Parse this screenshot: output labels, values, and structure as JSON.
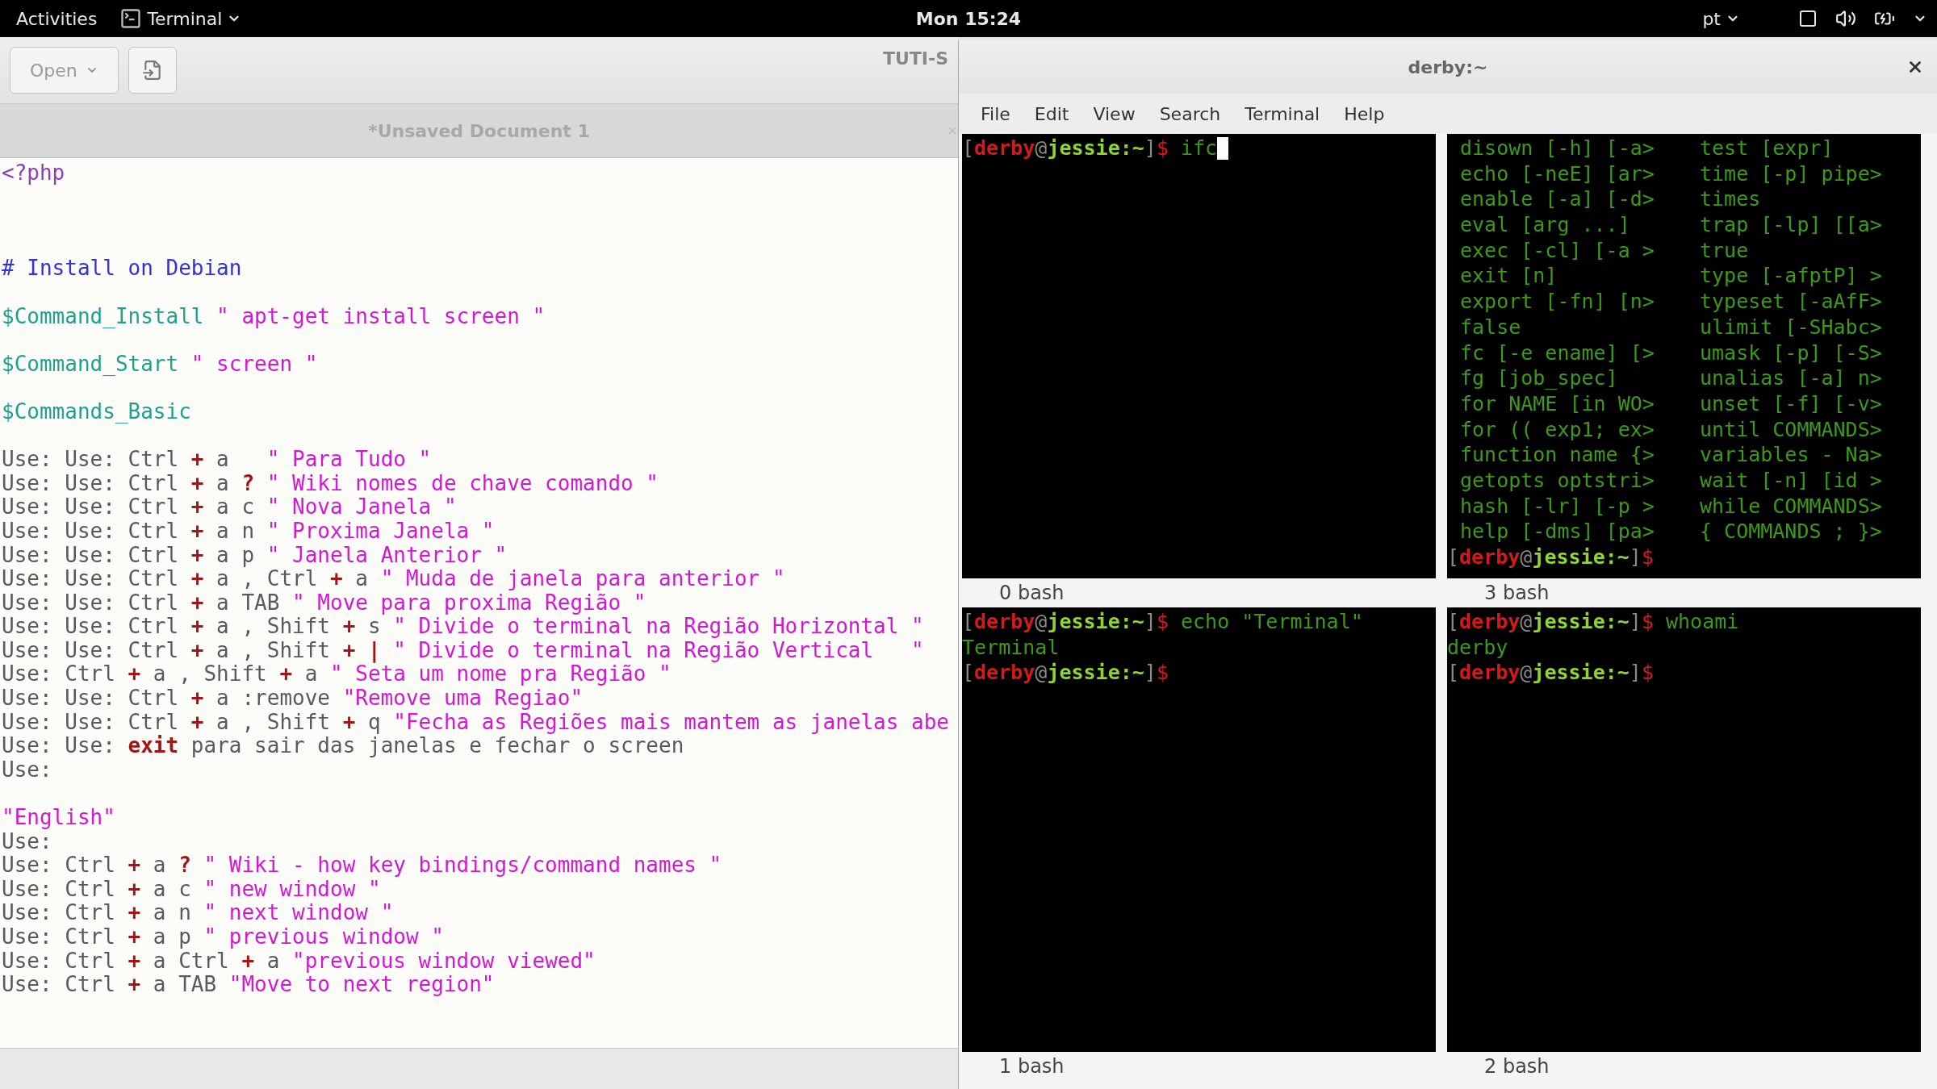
{
  "top_bar": {
    "activities": "Activities",
    "app_menu": "Terminal",
    "clock": "Mon 15:24",
    "keyboard_layout": "pt"
  },
  "editor": {
    "open_button": "Open",
    "title": "TUTI-S",
    "tab": {
      "label": "*Unsaved Document 1"
    },
    "blocks": [
      {
        "lines": [
          {
            "segments": [
              {
                "kind": "tag",
                "text": "<?php"
              }
            ]
          }
        ]
      },
      {
        "lines": [
          {
            "segments": [
              {
                "kind": "comment",
                "text": "# Install on Debian"
              }
            ]
          }
        ]
      },
      {
        "lines": [
          {
            "segments": [
              {
                "kind": "var",
                "text": "$Command_Install"
              },
              {
                "kind": "string",
                "text": " \" apt-get install screen \""
              }
            ]
          }
        ]
      },
      {
        "lines": [
          {
            "segments": [
              {
                "kind": "var",
                "text": "$Command_Start"
              },
              {
                "kind": "string",
                "text": " \" screen \""
              }
            ]
          }
        ]
      },
      {
        "lines": [
          {
            "segments": [
              {
                "kind": "var",
                "text": "$Commands_Basic"
              }
            ]
          }
        ]
      },
      {
        "lines": [
          {
            "segments": [
              {
                "kind": "plain",
                "text": "Use: Use: Ctrl "
              },
              {
                "kind": "key",
                "text": "+"
              },
              {
                "kind": "plain",
                "text": " a   "
              },
              {
                "kind": "string",
                "text": "\" Para Tudo \""
              }
            ]
          },
          {
            "segments": [
              {
                "kind": "plain",
                "text": "Use: Use: Ctrl "
              },
              {
                "kind": "key",
                "text": "+"
              },
              {
                "kind": "plain",
                "text": " a "
              },
              {
                "kind": "key",
                "text": "?"
              },
              {
                "kind": "string",
                "text": " \" Wiki nomes de chave comando \""
              }
            ]
          },
          {
            "segments": [
              {
                "kind": "plain",
                "text": "Use: Use: Ctrl "
              },
              {
                "kind": "key",
                "text": "+"
              },
              {
                "kind": "plain",
                "text": " a c "
              },
              {
                "kind": "string",
                "text": "\" Nova Janela \""
              }
            ]
          },
          {
            "segments": [
              {
                "kind": "plain",
                "text": "Use: Use: Ctrl "
              },
              {
                "kind": "key",
                "text": "+"
              },
              {
                "kind": "plain",
                "text": " a n "
              },
              {
                "kind": "string",
                "text": "\" Proxima Janela \""
              }
            ]
          },
          {
            "segments": [
              {
                "kind": "plain",
                "text": "Use: Use: Ctrl "
              },
              {
                "kind": "key",
                "text": "+"
              },
              {
                "kind": "plain",
                "text": " a p "
              },
              {
                "kind": "string",
                "text": "\" Janela Anterior \""
              }
            ]
          },
          {
            "segments": [
              {
                "kind": "plain",
                "text": "Use: Use: Ctrl "
              },
              {
                "kind": "key",
                "text": "+"
              },
              {
                "kind": "plain",
                "text": " a , Ctrl "
              },
              {
                "kind": "key",
                "text": "+"
              },
              {
                "kind": "plain",
                "text": " a "
              },
              {
                "kind": "string",
                "text": "\" Muda de janela para anterior \""
              }
            ]
          },
          {
            "segments": [
              {
                "kind": "plain",
                "text": "Use: Use: Ctrl "
              },
              {
                "kind": "key",
                "text": "+"
              },
              {
                "kind": "plain",
                "text": " a TAB "
              },
              {
                "kind": "string",
                "text": "\" Move para proxima Região \""
              }
            ]
          },
          {
            "segments": [
              {
                "kind": "plain",
                "text": "Use: Use: Ctrl "
              },
              {
                "kind": "key",
                "text": "+"
              },
              {
                "kind": "plain",
                "text": " a , Shift "
              },
              {
                "kind": "key",
                "text": "+"
              },
              {
                "kind": "plain",
                "text": " s "
              },
              {
                "kind": "string",
                "text": "\" Divide o terminal na Região Horizontal \""
              }
            ]
          },
          {
            "segments": [
              {
                "kind": "plain",
                "text": "Use: Use: Ctrl "
              },
              {
                "kind": "key",
                "text": "+"
              },
              {
                "kind": "plain",
                "text": " a , Shift "
              },
              {
                "kind": "key",
                "text": "+ |"
              },
              {
                "kind": "string",
                "text": " \" Divide o terminal na Região Vertical   \""
              }
            ]
          },
          {
            "segments": [
              {
                "kind": "plain",
                "text": "Use: Ctrl "
              },
              {
                "kind": "key",
                "text": "+"
              },
              {
                "kind": "plain",
                "text": " a , Shift "
              },
              {
                "kind": "key",
                "text": "+"
              },
              {
                "kind": "plain",
                "text": " a "
              },
              {
                "kind": "string",
                "text": "\" Seta um nome pra Região \""
              }
            ]
          },
          {
            "segments": [
              {
                "kind": "plain",
                "text": "Use: Use: Ctrl "
              },
              {
                "kind": "key",
                "text": "+"
              },
              {
                "kind": "plain",
                "text": " a :remove "
              },
              {
                "kind": "string",
                "text": "\"Remove uma Regiao\""
              }
            ]
          },
          {
            "segments": [
              {
                "kind": "plain",
                "text": "Use: Use: Ctrl "
              },
              {
                "kind": "key",
                "text": "+"
              },
              {
                "kind": "plain",
                "text": " a , Shift "
              },
              {
                "kind": "key",
                "text": "+"
              },
              {
                "kind": "plain",
                "text": " q "
              },
              {
                "kind": "string",
                "text": "\"Fecha as Regiões mais mantem as janelas abe"
              }
            ]
          },
          {
            "segments": [
              {
                "kind": "plain",
                "text": "Use: Use: "
              },
              {
                "kind": "key",
                "text": "exit"
              },
              {
                "kind": "plain",
                "text": " para sair das janelas e fechar o screen"
              }
            ]
          },
          {
            "segments": [
              {
                "kind": "plain",
                "text": "Use:"
              }
            ]
          }
        ]
      },
      {
        "lines": [
          {
            "segments": [
              {
                "kind": "string",
                "text": "\"English\""
              }
            ]
          },
          {
            "segments": [
              {
                "kind": "plain",
                "text": "Use:"
              }
            ]
          },
          {
            "segments": [
              {
                "kind": "plain",
                "text": "Use: Ctrl "
              },
              {
                "kind": "key",
                "text": "+"
              },
              {
                "kind": "plain",
                "text": " a "
              },
              {
                "kind": "key",
                "text": "?"
              },
              {
                "kind": "string",
                "text": " \" Wiki - how key bindings/command names \""
              }
            ]
          },
          {
            "segments": [
              {
                "kind": "plain",
                "text": "Use: Ctrl "
              },
              {
                "kind": "key",
                "text": "+"
              },
              {
                "kind": "plain",
                "text": " a c "
              },
              {
                "kind": "string",
                "text": "\" new window \""
              }
            ]
          },
          {
            "segments": [
              {
                "kind": "plain",
                "text": "Use: Ctrl "
              },
              {
                "kind": "key",
                "text": "+"
              },
              {
                "kind": "plain",
                "text": " a n "
              },
              {
                "kind": "string",
                "text": "\" next window \""
              }
            ]
          },
          {
            "segments": [
              {
                "kind": "plain",
                "text": "Use: Ctrl "
              },
              {
                "kind": "key",
                "text": "+"
              },
              {
                "kind": "plain",
                "text": " a p "
              },
              {
                "kind": "string",
                "text": "\" previous window \""
              }
            ]
          },
          {
            "segments": [
              {
                "kind": "plain",
                "text": "Use: Ctrl "
              },
              {
                "kind": "key",
                "text": "+"
              },
              {
                "kind": "plain",
                "text": " a Ctrl "
              },
              {
                "kind": "key",
                "text": "+"
              },
              {
                "kind": "plain",
                "text": " a "
              },
              {
                "kind": "string",
                "text": "\"previous window viewed\""
              }
            ]
          },
          {
            "segments": [
              {
                "kind": "plain",
                "text": "Use: Ctrl "
              },
              {
                "kind": "key",
                "text": "+"
              },
              {
                "kind": "plain",
                "text": " a TAB "
              },
              {
                "kind": "string",
                "text": "\"Move to next region\""
              }
            ]
          }
        ]
      }
    ]
  },
  "terminal": {
    "title": "derby:~",
    "menu": [
      "File",
      "Edit",
      "View",
      "Search",
      "Terminal",
      "Help"
    ],
    "panes": [
      {
        "status": "0 bash",
        "lines": [
          {
            "kind": "prompt",
            "parts": [
              "[",
              "derby",
              "@",
              "jessie:~",
              "]",
              "$"
            ],
            "command": "ifc",
            "cursor": true
          }
        ]
      },
      {
        "status": "3 bash",
        "lines": [
          {
            "kind": "columns",
            "left": "disown [-h] [-a>",
            "right": "test [expr]"
          },
          {
            "kind": "columns",
            "left": "echo [-neE] [ar>",
            "right": "time [-p] pipe>"
          },
          {
            "kind": "columns",
            "left": "enable [-a] [-d>",
            "right": "times"
          },
          {
            "kind": "columns",
            "left": "eval [arg ...]",
            "right": "trap [-lp] [[a>"
          },
          {
            "kind": "columns",
            "left": "exec [-cl] [-a >",
            "right": "true"
          },
          {
            "kind": "columns",
            "left": "exit [n]",
            "right": "type [-afptP] >"
          },
          {
            "kind": "columns",
            "left": "export [-fn] [n>",
            "right": "typeset [-aAfF>"
          },
          {
            "kind": "columns",
            "left": "false",
            "right": "ulimit [-SHabc>"
          },
          {
            "kind": "columns",
            "left": "fc [-e ename] [>",
            "right": "umask [-p] [-S>"
          },
          {
            "kind": "columns",
            "left": "fg [job_spec]",
            "right": "unalias [-a] n>"
          },
          {
            "kind": "columns",
            "left": "for NAME [in WO>",
            "right": "unset [-f] [-v>"
          },
          {
            "kind": "columns",
            "left": "for (( exp1; ex>",
            "right": "until COMMANDS>"
          },
          {
            "kind": "columns",
            "left": "function name {>",
            "right": "variables - Na>"
          },
          {
            "kind": "columns",
            "left": "getopts optstri>",
            "right": "wait [-n] [id >"
          },
          {
            "kind": "columns",
            "left": "hash [-lr] [-p >",
            "right": "while COMMANDS>"
          },
          {
            "kind": "columns",
            "left": "help [-dms] [pa>",
            "right": "{ COMMANDS ; }>"
          },
          {
            "kind": "prompt",
            "parts": [
              "[",
              "derby",
              "@",
              "jessie:~",
              "]",
              "$"
            ],
            "cursor": false
          }
        ]
      },
      {
        "status": "1 bash",
        "lines": [
          {
            "kind": "prompt",
            "parts": [
              "[",
              "derby",
              "@",
              "jessie:~",
              "]",
              "$"
            ],
            "command": "echo \"Terminal\"",
            "cursor": false
          },
          {
            "kind": "output",
            "text": "Terminal"
          },
          {
            "kind": "prompt",
            "parts": [
              "[",
              "derby",
              "@",
              "jessie:~",
              "]",
              "$"
            ],
            "cursor": false
          }
        ]
      },
      {
        "status": "2 bash",
        "lines": [
          {
            "kind": "prompt",
            "parts": [
              "[",
              "derby",
              "@",
              "jessie:~",
              "]",
              "$"
            ],
            "command": "whoami",
            "cursor": false
          },
          {
            "kind": "output",
            "text": "derby"
          },
          {
            "kind": "prompt",
            "parts": [
              "[",
              "derby",
              "@",
              "jessie:~",
              "]",
              "$"
            ],
            "cursor": false
          }
        ]
      }
    ]
  }
}
